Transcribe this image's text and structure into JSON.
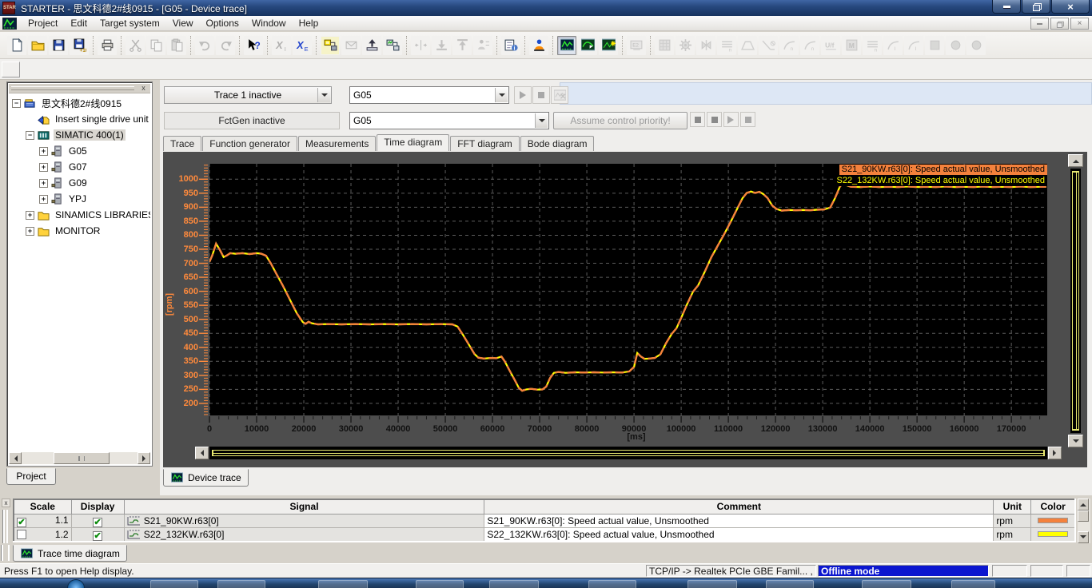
{
  "titlebar": {
    "title": "STARTER - 思文科德2#线0915 - [G05 - Device trace]",
    "app_icon": "STAR"
  },
  "menubar": {
    "items": [
      "Project",
      "Edit",
      "Target system",
      "View",
      "Options",
      "Window",
      "Help"
    ]
  },
  "toolbar": {
    "groups": [
      {
        "items": [
          {
            "name": "new",
            "icon": "page",
            "enabled": true
          },
          {
            "name": "open",
            "icon": "folder",
            "enabled": true
          },
          {
            "name": "save",
            "icon": "disk",
            "enabled": true
          },
          {
            "name": "save-id",
            "icon": "diskid",
            "enabled": true
          }
        ]
      },
      {
        "items": [
          {
            "name": "print",
            "icon": "printer",
            "enabled": true
          }
        ]
      },
      {
        "items": [
          {
            "name": "cut",
            "icon": "scissors",
            "enabled": false
          },
          {
            "name": "copy",
            "icon": "copy",
            "enabled": false
          },
          {
            "name": "paste",
            "icon": "paste",
            "enabled": false
          }
        ]
      },
      {
        "items": [
          {
            "name": "undo",
            "icon": "undo",
            "enabled": false
          },
          {
            "name": "redo",
            "icon": "redo",
            "enabled": false
          }
        ]
      },
      {
        "items": [
          {
            "name": "context-help",
            "icon": "helpcur",
            "enabled": true
          }
        ]
      },
      {
        "items": [
          {
            "name": "select-xi",
            "icon": "xi",
            "enabled": false
          },
          {
            "name": "select-xe",
            "icon": "xe",
            "enabled": true
          }
        ]
      },
      {
        "items": [
          {
            "name": "connect-target",
            "icon": "netyellow",
            "enabled": true,
            "highlight": true
          },
          {
            "name": "download-to-target",
            "icon": "mail",
            "enabled": false
          },
          {
            "name": "upload-to-pg",
            "icon": "upload",
            "enabled": true
          },
          {
            "name": "disconnect-target",
            "icon": "net2",
            "enabled": true
          }
        ]
      },
      {
        "items": [
          {
            "name": "align",
            "icon": "spread",
            "enabled": false
          },
          {
            "name": "load-to-device",
            "icon": "traydown",
            "enabled": false
          },
          {
            "name": "load-to-pg",
            "icon": "trayup",
            "enabled": false
          },
          {
            "name": "copy-ram-rom",
            "icon": "person2",
            "enabled": false
          }
        ]
      },
      {
        "items": [
          {
            "name": "show-project-data",
            "icon": "chartinfo",
            "enabled": true
          }
        ]
      },
      {
        "items": [
          {
            "name": "commissioning",
            "icon": "person",
            "enabled": true
          }
        ]
      },
      {
        "items": [
          {
            "name": "device-trace",
            "icon": "trace1",
            "enabled": true,
            "pressed": true
          },
          {
            "name": "measuring-function",
            "icon": "trace2",
            "enabled": true
          },
          {
            "name": "function-generator-icon",
            "icon": "trace3",
            "enabled": true
          }
        ]
      },
      {
        "items": [
          {
            "name": "pg-pc-settings",
            "icon": "pg",
            "enabled": false
          }
        ]
      },
      {
        "items": [
          {
            "name": "matrix",
            "icon": "grid",
            "enabled": false
          },
          {
            "name": "gear",
            "icon": "gear",
            "enabled": false
          },
          {
            "name": "valve",
            "icon": "valve",
            "enabled": false
          },
          {
            "name": "coil-n",
            "icon": "coil",
            "enabled": false
          },
          {
            "name": "trapezoid",
            "icon": "trap",
            "enabled": false
          },
          {
            "name": "ramp-down",
            "icon": "rampx",
            "enabled": false
          },
          {
            "name": "curve-n1",
            "icon": "curve",
            "enabled": false
          },
          {
            "name": "curve-n2",
            "icon": "curve",
            "enabled": false
          },
          {
            "name": "u-f-control",
            "icon": "uf",
            "enabled": false
          },
          {
            "name": "motor-module",
            "icon": "mbox",
            "enabled": false
          },
          {
            "name": "coil-m",
            "icon": "coil",
            "enabled": false
          },
          {
            "name": "curve-i1",
            "icon": "curvei",
            "enabled": false
          },
          {
            "name": "curve-i2",
            "icon": "curvei",
            "enabled": false
          },
          {
            "name": "square",
            "icon": "sq",
            "enabled": false
          },
          {
            "name": "circle-1",
            "icon": "circ",
            "enabled": false
          },
          {
            "name": "circle-2",
            "icon": "circ",
            "enabled": false
          }
        ]
      }
    ]
  },
  "tree": {
    "close_label": "x",
    "project_tab": "Project",
    "items": [
      {
        "label": "思文科德2#线0915",
        "level": 0,
        "expander": "minus",
        "icon": "project",
        "selected": false
      },
      {
        "label": "Insert single drive unit",
        "level": 1,
        "expander": "none",
        "icon": "insert",
        "selected": false
      },
      {
        "label": "SIMATIC 400(1)",
        "level": 1,
        "expander": "minus",
        "icon": "rack",
        "selected": true
      },
      {
        "label": "G05",
        "level": 2,
        "expander": "plus",
        "icon": "drive",
        "selected": false
      },
      {
        "label": "G07",
        "level": 2,
        "expander": "plus",
        "icon": "drive",
        "selected": false
      },
      {
        "label": "G09",
        "level": 2,
        "expander": "plus",
        "icon": "drive",
        "selected": false
      },
      {
        "label": "YPJ",
        "level": 2,
        "expander": "plus",
        "icon": "drive",
        "selected": false
      },
      {
        "label": "SINAMICS LIBRARIES",
        "level": 1,
        "expander": "plus",
        "icon": "folder",
        "selected": false
      },
      {
        "label": "MONITOR",
        "level": 1,
        "expander": "plus",
        "icon": "folder",
        "selected": false
      }
    ]
  },
  "trace_controls": {
    "trace_selector": "Trace 1 inactive",
    "device_combo1": "G05",
    "fctgen_label": "FctGen  inactive",
    "device_combo2": "G05",
    "assume_button": "Assume control priority!"
  },
  "trace_tabs": {
    "items": [
      "Trace",
      "Function generator",
      "Measurements",
      "Time diagram",
      "FFT diagram",
      "Bode diagram"
    ],
    "active": "Time diagram"
  },
  "chart_data": {
    "type": "line",
    "xlabel": "[ms]",
    "ylabel": "[rpm]",
    "xlim": [
      0,
      177600
    ],
    "ylim": [
      157,
      1055
    ],
    "x_ticks": [
      0,
      10000,
      20000,
      30000,
      40000,
      50000,
      60000,
      70000,
      80000,
      90000,
      100000,
      110000,
      120000,
      130000,
      140000,
      150000,
      160000,
      170000
    ],
    "y_ticks": [
      200,
      250,
      300,
      350,
      400,
      450,
      500,
      550,
      600,
      650,
      700,
      750,
      800,
      850,
      900,
      950,
      1000
    ],
    "x_minor_step": 2000,
    "y_minor_step": 10,
    "grid": true,
    "plot_bg": "#000000",
    "grid_color": "#5c5c5c",
    "axis_color": "#ff8a3c",
    "legend_position": "top-right",
    "legend": [
      {
        "label": "S21_90KW.r63[0]: Speed actual value, Unsmoothed",
        "fg": "#000000",
        "bg": "#f4813c"
      },
      {
        "label": "S22_132KW.r63[0]: Speed actual value, Unsmoothed",
        "fg": "#ffff00",
        "bg": "#000000"
      }
    ],
    "series": [
      {
        "name": "S21_90KW.r63[0]",
        "color": "#f4813c",
        "points": [
          [
            0,
            705
          ],
          [
            600,
            728
          ],
          [
            1400,
            770
          ],
          [
            2200,
            748
          ],
          [
            3000,
            722
          ],
          [
            3700,
            728
          ],
          [
            4400,
            736
          ],
          [
            5500,
            734
          ],
          [
            7000,
            736
          ],
          [
            8500,
            733
          ],
          [
            10000,
            736
          ],
          [
            11000,
            734
          ],
          [
            12000,
            727
          ],
          [
            13000,
            700
          ],
          [
            14200,
            662
          ],
          [
            15500,
            622
          ],
          [
            17000,
            572
          ],
          [
            18500,
            522
          ],
          [
            19800,
            490
          ],
          [
            20400,
            484
          ],
          [
            21000,
            491
          ],
          [
            21700,
            486
          ],
          [
            23000,
            482
          ],
          [
            25000,
            483
          ],
          [
            28000,
            482
          ],
          [
            31000,
            483
          ],
          [
            34000,
            482
          ],
          [
            37000,
            483
          ],
          [
            40000,
            482
          ],
          [
            43000,
            483
          ],
          [
            46000,
            482
          ],
          [
            49000,
            483
          ],
          [
            51500,
            482
          ],
          [
            52600,
            474
          ],
          [
            53800,
            443
          ],
          [
            55000,
            410
          ],
          [
            56200,
            376
          ],
          [
            57000,
            363
          ],
          [
            58200,
            360
          ],
          [
            59500,
            362
          ],
          [
            60800,
            361
          ],
          [
            61900,
            367
          ],
          [
            62600,
            350
          ],
          [
            63600,
            318
          ],
          [
            64700,
            284
          ],
          [
            65600,
            255
          ],
          [
            66300,
            245
          ],
          [
            67200,
            250
          ],
          [
            68200,
            252
          ],
          [
            69500,
            249
          ],
          [
            70600,
            250
          ],
          [
            71400,
            260
          ],
          [
            72200,
            290
          ],
          [
            73000,
            309
          ],
          [
            74000,
            312
          ],
          [
            75500,
            309
          ],
          [
            77500,
            311
          ],
          [
            79500,
            310
          ],
          [
            81500,
            311
          ],
          [
            83500,
            310
          ],
          [
            85500,
            311
          ],
          [
            87500,
            310
          ],
          [
            89000,
            314
          ],
          [
            90000,
            330
          ],
          [
            90700,
            380
          ],
          [
            91400,
            368
          ],
          [
            92200,
            359
          ],
          [
            93200,
            360
          ],
          [
            94400,
            362
          ],
          [
            95600,
            375
          ],
          [
            96800,
            415
          ],
          [
            98000,
            448
          ],
          [
            99000,
            468
          ],
          [
            100000,
            505
          ],
          [
            101200,
            552
          ],
          [
            102500,
            598
          ],
          [
            103600,
            621
          ],
          [
            105000,
            670
          ],
          [
            106400,
            722
          ],
          [
            107600,
            758
          ],
          [
            109000,
            800
          ],
          [
            110400,
            845
          ],
          [
            111800,
            892
          ],
          [
            113000,
            932
          ],
          [
            113900,
            951
          ],
          [
            114800,
            956
          ],
          [
            115700,
            951
          ],
          [
            116600,
            955
          ],
          [
            117400,
            947
          ],
          [
            118300,
            933
          ],
          [
            119300,
            906
          ],
          [
            120200,
            894
          ],
          [
            121300,
            888
          ],
          [
            122800,
            890
          ],
          [
            124300,
            889
          ],
          [
            125800,
            890
          ],
          [
            127300,
            889
          ],
          [
            128800,
            891
          ],
          [
            130300,
            892
          ],
          [
            131600,
            899
          ],
          [
            132600,
            932
          ],
          [
            133600,
            972
          ],
          [
            134300,
            988
          ],
          [
            135100,
            978
          ],
          [
            136000,
            973
          ],
          [
            138000,
            972
          ],
          [
            140000,
            974
          ],
          [
            142000,
            972
          ],
          [
            144000,
            973
          ],
          [
            146000,
            972
          ],
          [
            148000,
            974
          ],
          [
            150000,
            972
          ],
          [
            152000,
            973
          ],
          [
            154000,
            972
          ],
          [
            156000,
            974
          ],
          [
            158000,
            972
          ],
          [
            160000,
            973
          ],
          [
            162000,
            972
          ],
          [
            164000,
            974
          ],
          [
            166000,
            972
          ],
          [
            168000,
            973
          ],
          [
            170000,
            972
          ],
          [
            172000,
            974
          ],
          [
            174000,
            972
          ],
          [
            176000,
            973
          ],
          [
            177400,
            973
          ]
        ]
      },
      {
        "name": "S22_132KW.r63[0]",
        "color": "#ffff00",
        "points_same_as": 0
      }
    ]
  },
  "device_trace_tab": "Device trace",
  "signal_table": {
    "headers": [
      "Scale",
      "Display",
      "Signal",
      "Comment",
      "Unit",
      "Color"
    ],
    "rows": [
      {
        "scale_checked": true,
        "scale": "1.1",
        "display_checked": true,
        "signal": "S21_90KW.r63[0]",
        "comment": "S21_90KW.r63[0]: Speed actual value, Unsmoothed",
        "unit": "rpm",
        "color": "#f4813c"
      },
      {
        "scale_checked": false,
        "scale": "1.2",
        "display_checked": true,
        "signal": "S22_132KW.r63[0]",
        "comment": "S22_132KW.r63[0]: Speed actual value, Unsmoothed",
        "unit": "rpm",
        "color": "#ffff00"
      }
    ],
    "tab": "Trace time diagram"
  },
  "status_bar": {
    "help_text": "Press F1 to open Help display.",
    "connection": "TCP/IP -> Realtek PCIe GBE Famil... ,",
    "mode": "Offline mode"
  }
}
